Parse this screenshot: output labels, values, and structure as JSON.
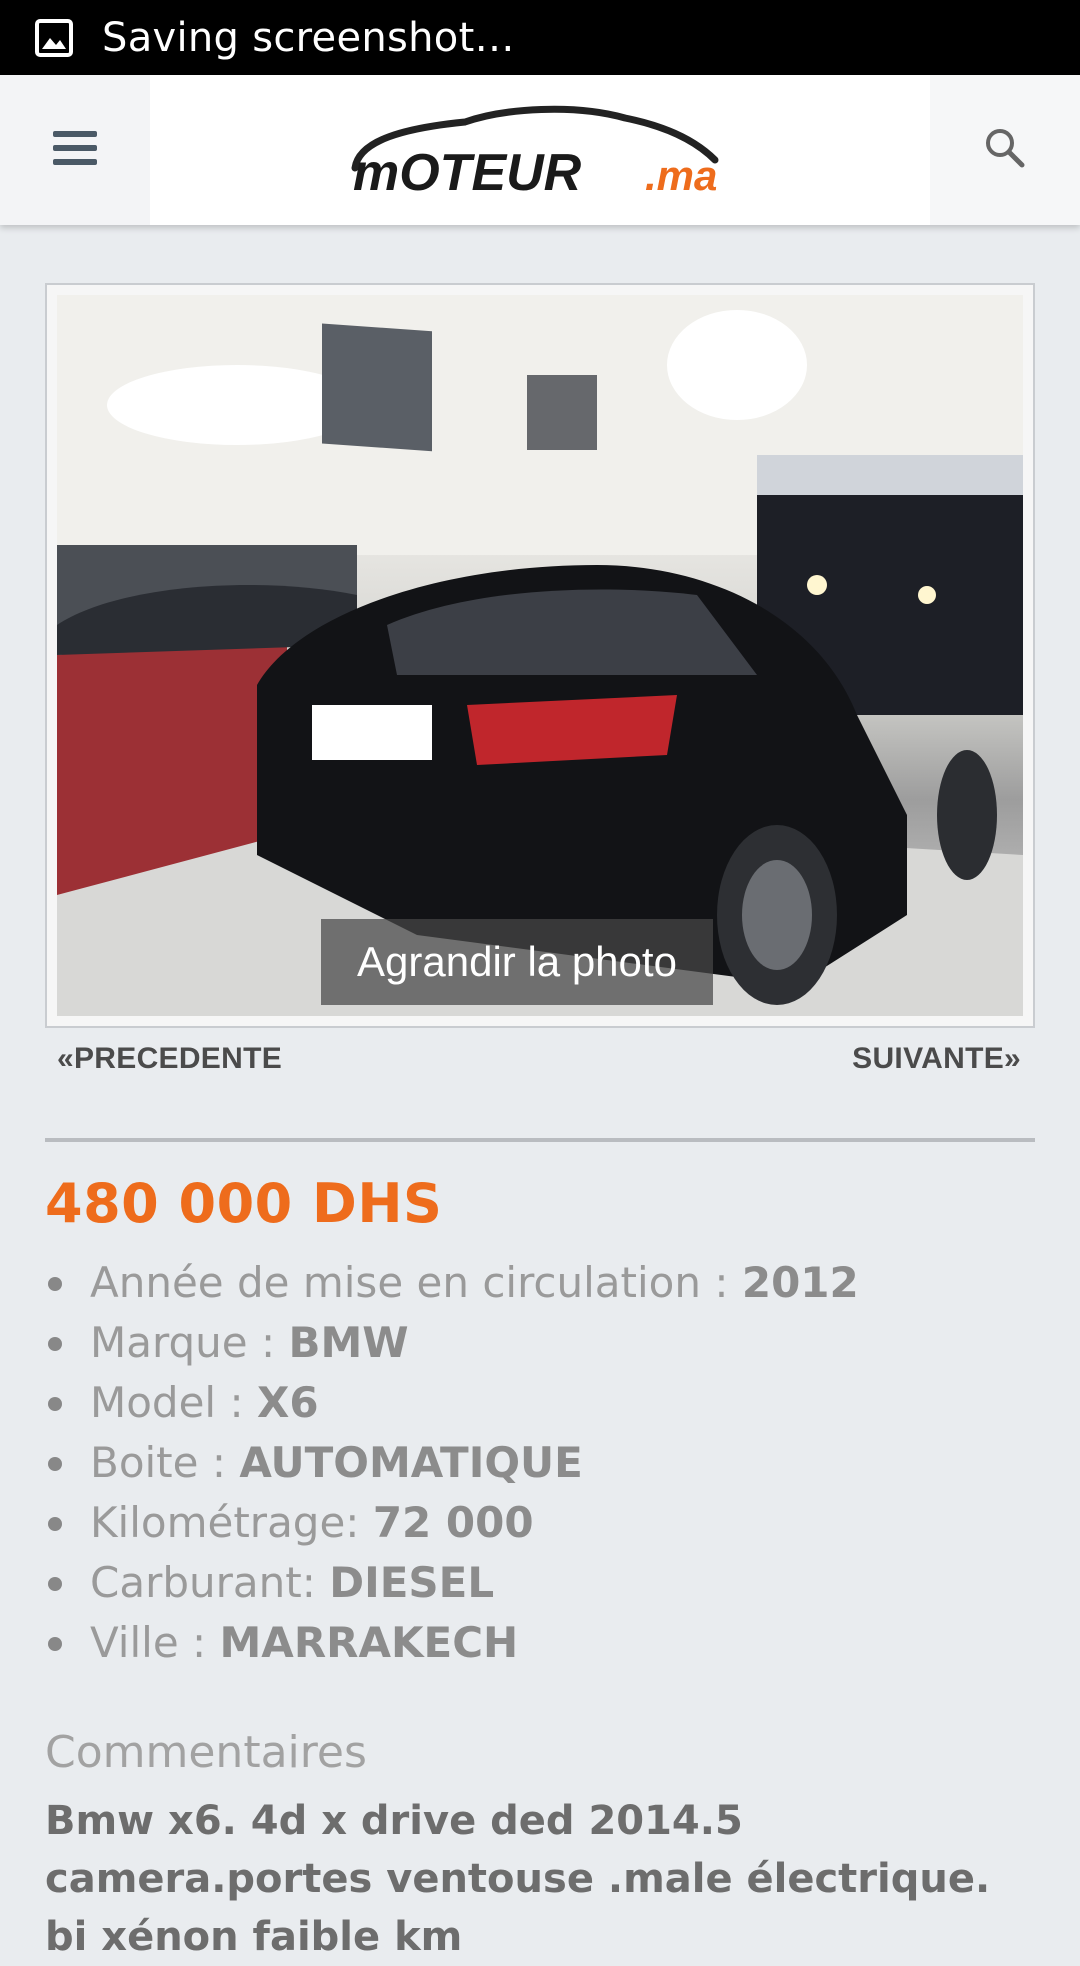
{
  "status_bar": {
    "icon": "image-icon",
    "text": "Saving screenshot…"
  },
  "header": {
    "menu_icon": "hamburger-icon",
    "logo_text_main": "mOTEUR",
    "logo_text_suffix": ".ma",
    "search_icon": "search-icon"
  },
  "photo": {
    "enlarge_label": "Agrandir la photo"
  },
  "pager": {
    "prev_label": "«PRECEDENTE",
    "next_label": "SUIVANTE»"
  },
  "listing": {
    "price": "480 000 DHS",
    "price_color": "#ee6c1c",
    "specs": [
      {
        "label": "Année de mise en circulation : ",
        "value": "2012"
      },
      {
        "label": "Marque : ",
        "value": "BMW"
      },
      {
        "label": "Model : ",
        "value": "X6"
      },
      {
        "label": "Boite : ",
        "value": "AUTOMATIQUE"
      },
      {
        "label": "Kilométrage: ",
        "value": "72 000"
      },
      {
        "label": "Carburant: ",
        "value": "DIESEL"
      },
      {
        "label": "Ville : ",
        "value": "MARRAKECH"
      }
    ],
    "comments_title": "Commentaires",
    "comments_text": "Bmw x6. 4d x drive ded 2014.5 camera.portes ventouse .male électrique. bi xénon faible km"
  }
}
